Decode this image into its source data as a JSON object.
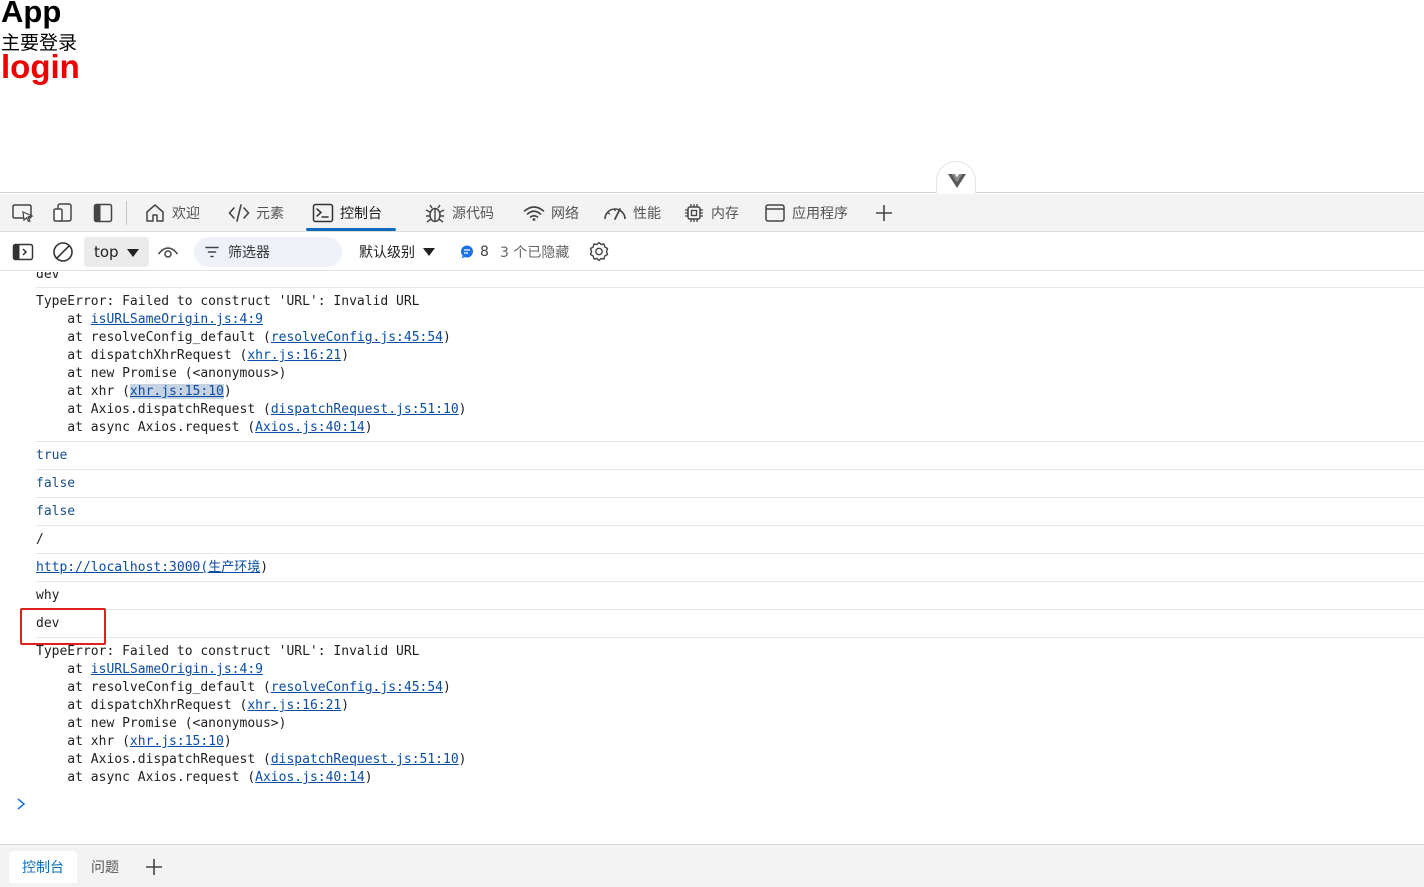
{
  "page": {
    "title": "App",
    "subtitle": "主要登录",
    "heading": "login"
  },
  "devtools": {
    "tabs": [
      {
        "label": "欢迎",
        "icon": "home-icon"
      },
      {
        "label": "元素",
        "icon": "code-icon"
      },
      {
        "label": "控制台",
        "icon": "console-icon",
        "active": true
      },
      {
        "label": "源代码",
        "icon": "bug-icon"
      },
      {
        "label": "网络",
        "icon": "wifi-icon"
      },
      {
        "label": "性能",
        "icon": "gauge-icon"
      },
      {
        "label": "内存",
        "icon": "chip-icon"
      },
      {
        "label": "应用程序",
        "icon": "window-icon"
      }
    ],
    "toolbar": {
      "context": "top",
      "filter_placeholder": "筛选器",
      "levels": "默认级别",
      "message_count": "8",
      "hidden": "3 个已隐藏"
    },
    "drawer_tabs": [
      "控制台",
      "问题"
    ]
  },
  "console": {
    "messages": [
      {
        "text": "dev"
      },
      {
        "stack": {
          "header": "TypeError: Failed to construct 'URL': Invalid URL",
          "frames": [
            {
              "prefix": "    at ",
              "fn": "",
              "link": "isURLSameOrigin.js:4:9",
              "suffix": ""
            },
            {
              "prefix": "    at resolveConfig_default (",
              "link": "resolveConfig.js:45:54",
              "suffix": ")"
            },
            {
              "prefix": "    at dispatchXhrRequest (",
              "link": "xhr.js:16:21",
              "suffix": ")"
            },
            {
              "prefix": "    at new Promise (<anonymous>)",
              "link": "",
              "suffix": ""
            },
            {
              "prefix": "    at xhr (",
              "link": "xhr.js:15:10",
              "suffix": ")",
              "selected": true
            },
            {
              "prefix": "    at Axios.dispatchRequest (",
              "link": "dispatchRequest.js:51:10",
              "suffix": ")"
            },
            {
              "prefix": "    at async Axios.request (",
              "link": "Axios.js:40:14",
              "suffix": ")"
            }
          ]
        }
      },
      {
        "value": "true"
      },
      {
        "value": "false"
      },
      {
        "value": "false"
      },
      {
        "text": "/"
      },
      {
        "url": "http://localhost:3000",
        "tail": "(生产环境",
        "close": ")"
      },
      {
        "text": "why"
      },
      {
        "text": "dev"
      },
      {
        "stack": {
          "header": "TypeError: Failed to construct 'URL': Invalid URL",
          "frames": [
            {
              "prefix": "    at ",
              "link": "isURLSameOrigin.js:4:9",
              "suffix": ""
            },
            {
              "prefix": "    at resolveConfig_default (",
              "link": "resolveConfig.js:45:54",
              "suffix": ")"
            },
            {
              "prefix": "    at dispatchXhrRequest (",
              "link": "xhr.js:16:21",
              "suffix": ")"
            },
            {
              "prefix": "    at new Promise (<anonymous>)",
              "link": "",
              "suffix": ""
            },
            {
              "prefix": "    at xhr (",
              "link": "xhr.js:15:10",
              "suffix": ")"
            },
            {
              "prefix": "    at Axios.dispatchRequest (",
              "link": "dispatchRequest.js:51:10",
              "suffix": ")"
            },
            {
              "prefix": "    at async Axios.request (",
              "link": "Axios.js:40:14",
              "suffix": ")"
            }
          ]
        }
      }
    ]
  },
  "colors": {
    "accent": "#0f6cbd",
    "login_red": "#ee0000",
    "highlight_box": "#e02020",
    "link": "#0b4da2"
  }
}
